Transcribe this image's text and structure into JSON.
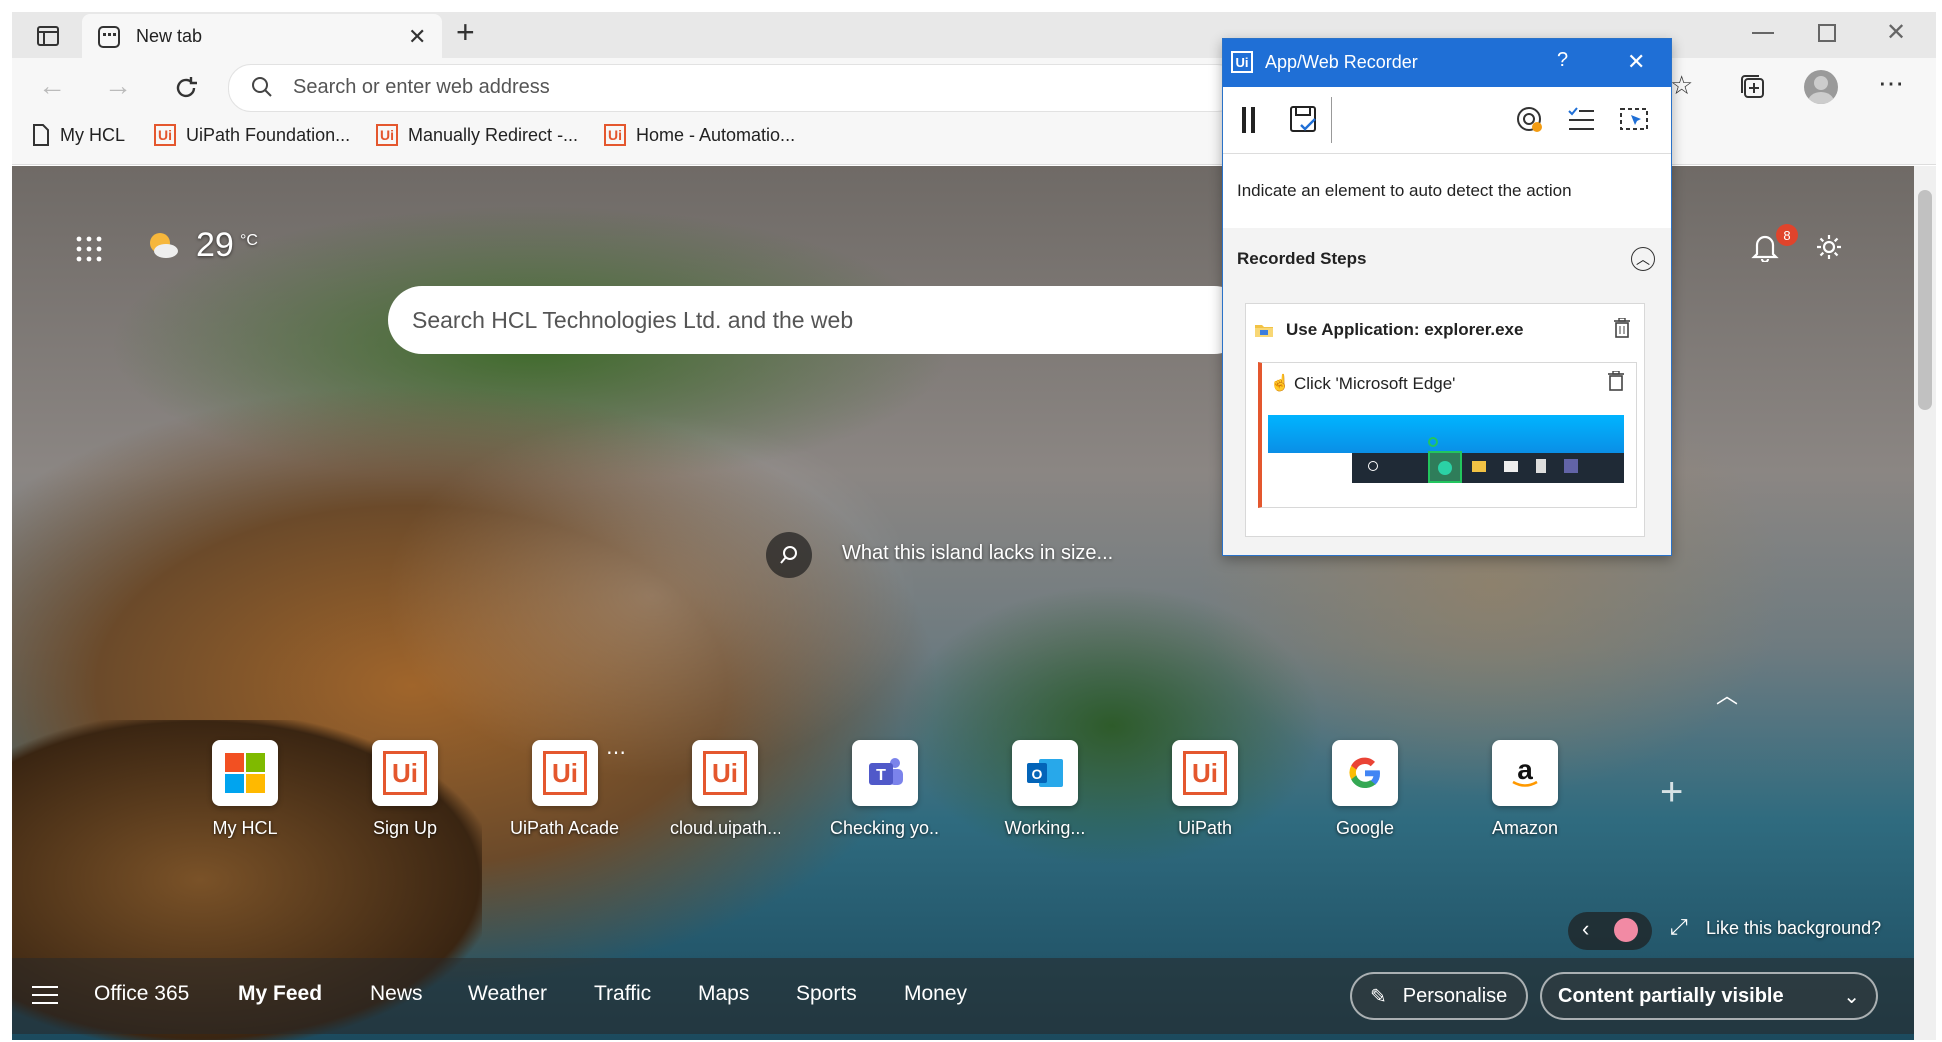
{
  "tab": {
    "title": "New tab"
  },
  "address_bar": {
    "placeholder": "Search or enter web address"
  },
  "bookmarks": [
    {
      "label": "My HCL"
    },
    {
      "label": "UiPath Foundation..."
    },
    {
      "label": "Manually Redirect -..."
    },
    {
      "label": "Home - Automatio..."
    }
  ],
  "weather": {
    "temp": "29",
    "unit": "°C"
  },
  "notifications": {
    "count": "8"
  },
  "page_search": {
    "placeholder": "Search HCL Technologies Ltd. and the web"
  },
  "caption": "What this island lacks in size...",
  "quick_links": [
    {
      "label": "My HCL"
    },
    {
      "label": "Sign Up"
    },
    {
      "label": "UiPath Acade..."
    },
    {
      "label": "cloud.uipath...."
    },
    {
      "label": "Checking yo..."
    },
    {
      "label": "Working..."
    },
    {
      "label": "UiPath"
    },
    {
      "label": "Google"
    },
    {
      "label": "Amazon"
    }
  ],
  "background": {
    "like_label": "Like this background?"
  },
  "feed": {
    "items": [
      "Office 365",
      "My Feed",
      "News",
      "Weather",
      "Traffic",
      "Maps",
      "Sports",
      "Money"
    ],
    "personalise": "Personalise",
    "visibility": "Content partially visible"
  },
  "recorder": {
    "title": "App/Web Recorder",
    "help": "?",
    "hint": "Indicate an element to auto detect the action",
    "recorded_steps_label": "Recorded Steps",
    "steps": [
      {
        "label": "Use Application: explorer.exe"
      },
      {
        "label": "Click 'Microsoft Edge'"
      }
    ]
  }
}
